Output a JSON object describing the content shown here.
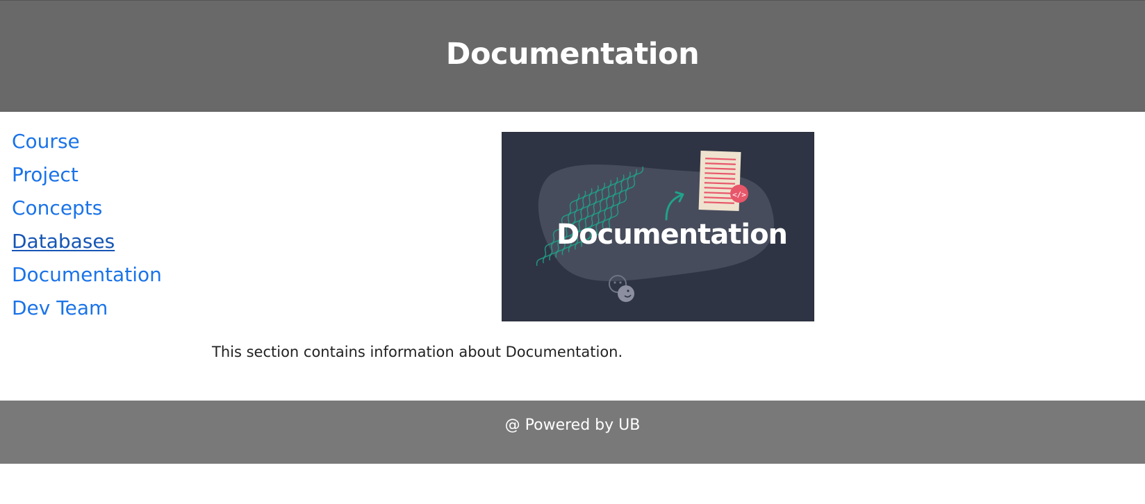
{
  "header": {
    "title": "Documentation"
  },
  "sidebar": {
    "items": [
      {
        "label": "Course"
      },
      {
        "label": "Project"
      },
      {
        "label": "Concepts"
      },
      {
        "label": "Databases"
      },
      {
        "label": "Documentation"
      },
      {
        "label": "Dev Team"
      }
    ]
  },
  "main": {
    "banner": {
      "caption": "Documentation",
      "code_badge": "</>",
      "icons": [
        "code-document-icon",
        "arrow-icon",
        "wave-lines-icon",
        "face-icons"
      ]
    },
    "description": "This section contains information about Documentation."
  },
  "footer": {
    "text": "@ Powered by UB"
  },
  "colors": {
    "header_bg": "#696969",
    "footer_bg": "#797979",
    "link": "#1a73e8",
    "link_active": "#1555b5",
    "banner_bg": "#2f3444",
    "banner_blob": "#474c5c",
    "wave": "#1fa38a",
    "accent_red": "#e8566a"
  }
}
